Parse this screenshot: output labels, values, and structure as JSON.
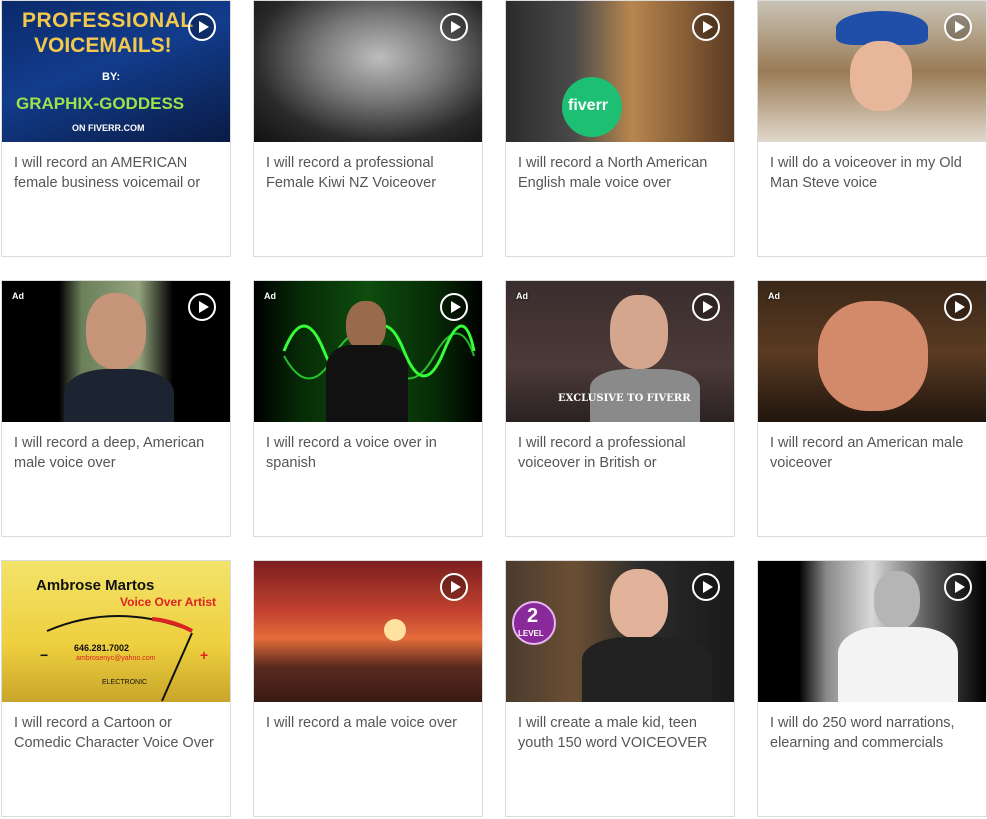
{
  "gigs": [
    {
      "title": "I will record an AMERICAN female business voicemail or",
      "ad": ""
    },
    {
      "title": "I will record a professional Female Kiwi NZ Voiceover",
      "ad": ""
    },
    {
      "title": "I will record a North American English male voice over",
      "ad": ""
    },
    {
      "title": "I will do a voiceover in my Old Man Steve voice",
      "ad": ""
    },
    {
      "title": "I will record a deep, American male voice over",
      "ad": "Ad"
    },
    {
      "title": "I will record a voice over in spanish",
      "ad": "Ad"
    },
    {
      "title": "I will record a professional voiceover in British or",
      "ad": "Ad"
    },
    {
      "title": "I will record an American male voiceover",
      "ad": "Ad"
    },
    {
      "title": "I will record a Cartoon or Comedic Character Voice Over",
      "ad": ""
    },
    {
      "title": "I will record a male voice over",
      "ad": ""
    },
    {
      "title": "I will create a male kid, teen youth 150 word VOICEOVER",
      "ad": ""
    },
    {
      "title": "I will do 250 word narrations, elearning and commercials",
      "ad": ""
    }
  ],
  "thumb_text": {
    "t1_line1": "PROFESSIONAL",
    "t1_line2": "VOICEMAILS!",
    "t1_by": "BY:",
    "t1_brand": "GRAPHIX-GODDESS",
    "t1_site": "ON FIVERR.COM",
    "t3_logo": "fiverr",
    "t7_caption": "EXCLUSIVE TO FIVERR",
    "t9_name": "Ambrose Martos",
    "t9_role": "Voice Over Artist",
    "t9_phone": "646.281.7002",
    "t9_email": "ambrosenyc@yahoo.com",
    "t9_meter_minus": "−",
    "t9_meter_plus": "+",
    "t9_meter_brand": "ELECTRONIC",
    "t11_badge_num": "2",
    "t11_badge_text": "LEVEL"
  }
}
